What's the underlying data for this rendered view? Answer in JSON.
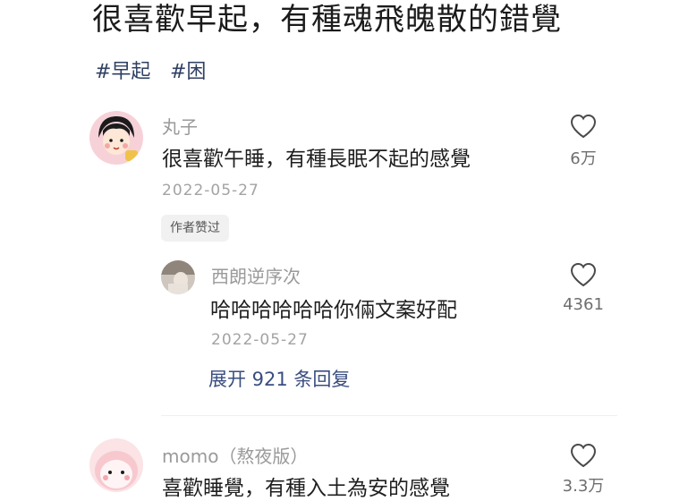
{
  "post": {
    "title": "很喜歡早起，有種魂飛魄散的錯覺",
    "tags": [
      "#早起",
      "#困"
    ]
  },
  "comments": [
    {
      "user": "丸子",
      "text": "很喜歡午睡，有種長眠不起的感覺",
      "date": "2022-05-27",
      "likes": "6万",
      "badge": "作者赞过",
      "reply": {
        "user": "西朗逆序次",
        "text": "哈哈哈哈哈哈你倆文案好配",
        "date": "2022-05-27",
        "likes": "4361"
      },
      "expand_label": "展开 921 条回复"
    },
    {
      "user": "momo（熬夜版）",
      "text": "喜歡睡覺，有種入土為安的感覺",
      "likes": "3.3万"
    }
  ],
  "colors": {
    "tag": "#2f3f63",
    "expand_link": "#3a4e80",
    "muted": "#9a9a9a"
  },
  "icons": {
    "like": "heart-outline-icon"
  }
}
